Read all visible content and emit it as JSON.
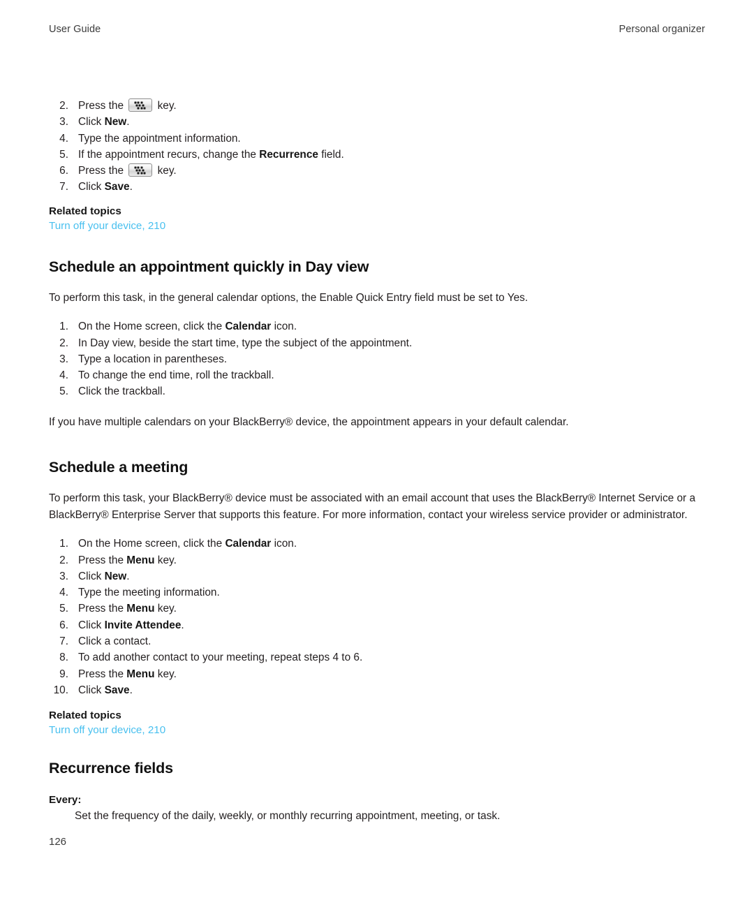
{
  "header": {
    "left": "User Guide",
    "right": "Personal organizer"
  },
  "footer": {
    "page_number": "126"
  },
  "colors": {
    "link": "#49c0ef",
    "text": "#231f20",
    "heading": "#111111"
  },
  "sections": [
    {
      "id": "appointment-steps-continued",
      "steps": [
        {
          "num": "2.",
          "pre": "Press the ",
          "icon": "blackberry-menu-key-icon",
          "post": " key.",
          "bold": ""
        },
        {
          "num": "3.",
          "pre": "Click ",
          "bold": "New",
          "post": "."
        },
        {
          "num": "4.",
          "pre": "Type the appointment information.",
          "bold": "",
          "post": ""
        },
        {
          "num": "5.",
          "pre": "If the appointment recurs, change the ",
          "bold": "Recurrence",
          "post": " field."
        },
        {
          "num": "6.",
          "pre": "Press the ",
          "icon": "blackberry-menu-key-icon",
          "post": " key.",
          "bold": ""
        },
        {
          "num": "7.",
          "pre": "Click ",
          "bold": "Save",
          "post": "."
        }
      ],
      "related": {
        "title": "Related topics",
        "link": "Turn off your device, 210"
      }
    },
    {
      "id": "schedule-appointment-day-view",
      "heading": "Schedule an appointment quickly in Day view",
      "intro": "To perform this task, in the general calendar options, the Enable Quick Entry field must be set to Yes.",
      "steps": [
        {
          "num": "1.",
          "pre": "On the Home screen, click the ",
          "bold": "Calendar",
          "post": " icon."
        },
        {
          "num": "2.",
          "pre": "In Day view, beside the start time, type the subject of the appointment.",
          "bold": "",
          "post": ""
        },
        {
          "num": "3.",
          "pre": "Type a location in parentheses.",
          "bold": "",
          "post": ""
        },
        {
          "num": "4.",
          "pre": "To change the end time, roll the trackball.",
          "bold": "",
          "post": ""
        },
        {
          "num": "5.",
          "pre": "Click the trackball.",
          "bold": "",
          "post": ""
        }
      ],
      "note": "If you have multiple calendars on your BlackBerry® device, the appointment appears in your default calendar."
    },
    {
      "id": "schedule-a-meeting",
      "heading": "Schedule a meeting",
      "intro": "To perform this task, your BlackBerry® device must be associated with an email account that uses the BlackBerry® Internet Service or a BlackBerry® Enterprise Server that supports this feature. For more information, contact your wireless service provider or administrator.",
      "steps": [
        {
          "num": "1.",
          "pre": "On the Home screen, click the ",
          "bold": "Calendar",
          "post": " icon."
        },
        {
          "num": "2.",
          "pre": "Press the ",
          "bold": "Menu",
          "post": " key."
        },
        {
          "num": "3.",
          "pre": "Click ",
          "bold": "New",
          "post": "."
        },
        {
          "num": "4.",
          "pre": "Type the meeting information.",
          "bold": "",
          "post": ""
        },
        {
          "num": "5.",
          "pre": "Press the ",
          "bold": "Menu",
          "post": " key."
        },
        {
          "num": "6.",
          "pre": "Click ",
          "bold": "Invite Attendee",
          "post": "."
        },
        {
          "num": "7.",
          "pre": "Click a contact.",
          "bold": "",
          "post": ""
        },
        {
          "num": "8.",
          "pre": "To add another contact to your meeting, repeat steps 4 to 6.",
          "bold": "",
          "post": ""
        },
        {
          "num": "9.",
          "pre": "Press the ",
          "bold": "Menu",
          "post": " key."
        },
        {
          "num": "10.",
          "pre": "Click ",
          "bold": "Save",
          "post": "."
        }
      ],
      "related": {
        "title": "Related topics",
        "link": "Turn off your device, 210"
      }
    },
    {
      "id": "recurrence-fields",
      "heading": "Recurrence fields",
      "definitions": [
        {
          "term": "Every:",
          "description": "Set the frequency of the daily, weekly, or monthly recurring appointment, meeting, or task."
        }
      ]
    }
  ]
}
